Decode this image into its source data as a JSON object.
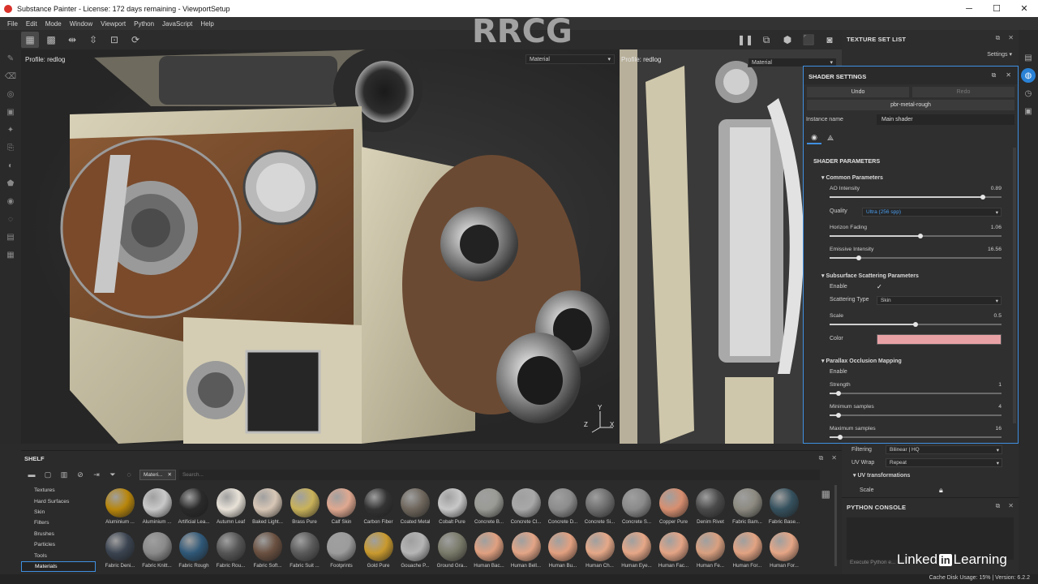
{
  "window": {
    "title": "Substance Painter - License: 172 days remaining - ViewportSetup"
  },
  "menu": [
    "File",
    "Edit",
    "Mode",
    "Window",
    "Viewport",
    "Python",
    "JavaScript",
    "Help"
  ],
  "viewport3d": {
    "profile": "Profile: redlog",
    "channel": "Material",
    "axis_y": "Y",
    "axis_x": "X",
    "axis_z": "Z"
  },
  "viewport2d": {
    "profile": "Profile: redlog",
    "channel": "Material"
  },
  "texture_set_list": {
    "title": "TEXTURE SET LIST",
    "settings": "Settings"
  },
  "shader_settings": {
    "title": "SHADER SETTINGS",
    "undo": "Undo",
    "redo": "Redo",
    "shader": "pbr-metal-rough",
    "instance_label": "Instance name",
    "instance_value": "Main shader",
    "params_header": "SHADER PARAMETERS",
    "common": {
      "title": "Common Parameters",
      "ao_label": "AO Intensity",
      "ao_value": "0.89",
      "ao": 0.89,
      "quality_label": "Quality",
      "quality_value": "Ultra (256 spp)",
      "horizon_label": "Horizon Fading",
      "horizon_value": "1.06",
      "horizon": 0.53,
      "emissive_label": "Emissive Intensity",
      "emissive_value": "16.56",
      "emissive": 0.17
    },
    "sss": {
      "title": "Subsurface Scattering Parameters",
      "enable_label": "Enable",
      "enable_check": "✓",
      "type_label": "Scattering Type",
      "type_value": "Skin",
      "scale_label": "Scale",
      "scale_value": "0.5",
      "scale": 0.5,
      "color_label": "Color",
      "color": "#e8a2a6"
    },
    "pom": {
      "title": "Parallax Occlusion Mapping",
      "enable_label": "Enable",
      "strength_label": "Strength",
      "strength_value": "1",
      "strength": 0.05,
      "min_label": "Minimum samples",
      "min_value": "4",
      "min": 0.05,
      "max_label": "Maximum samples",
      "max_value": "16",
      "max": 0.06
    }
  },
  "properties_peek": {
    "filtering_label": "Filtering",
    "filtering_value": "Bilinear | HQ",
    "uvwrap_label": "UV Wrap",
    "uvwrap_value": "Repeat",
    "uvtrans_label": "UV transformations",
    "scale_label": "Scale"
  },
  "python_console": {
    "title": "PYTHON CONSOLE",
    "hint": "Execute Python e..."
  },
  "shelf": {
    "title": "SHELF",
    "filter_chip": "Materi...",
    "search_placeholder": "Search...",
    "categories": [
      "Textures",
      "Hard Surfaces",
      "Skin",
      "Filters",
      "Brushes",
      "Particles",
      "Tools",
      "Materials"
    ],
    "materials_row1": [
      {
        "name": "Aluminium ...",
        "color": "#b8860b"
      },
      {
        "name": "Aluminium ...",
        "color": "#c9c9c9"
      },
      {
        "name": "Artificial Lea...",
        "color": "#2a2a2a"
      },
      {
        "name": "Autumn Leaf",
        "color": "#e8e2d8"
      },
      {
        "name": "Baked Light...",
        "color": "#d8c7b6"
      },
      {
        "name": "Brass Pure",
        "color": "#c9b25a"
      },
      {
        "name": "Calf Skin",
        "color": "#e0a890"
      },
      {
        "name": "Carbon Fiber",
        "color": "#333333"
      },
      {
        "name": "Coated Metal",
        "color": "#6e665c"
      },
      {
        "name": "Cobalt Pure",
        "color": "#c8c8c8"
      },
      {
        "name": "Concrete B...",
        "color": "#9a9a95"
      },
      {
        "name": "Concrete Cl...",
        "color": "#a8a8a8"
      },
      {
        "name": "Concrete D...",
        "color": "#8c8c8c"
      },
      {
        "name": "Concrete Si...",
        "color": "#6e6e6e"
      },
      {
        "name": "Concrete S...",
        "color": "#8a8a8a"
      },
      {
        "name": "Copper Pure",
        "color": "#d88f70"
      },
      {
        "name": "Denim Rivet",
        "color": "#4a4a4a"
      },
      {
        "name": "Fabric Bam...",
        "color": "#8c8a80"
      },
      {
        "name": "Fabric Base...",
        "color": "#35515e"
      }
    ],
    "materials_row2": [
      {
        "name": "Fabric Deni...",
        "color": "#3a4350"
      },
      {
        "name": "Fabric Knitt...",
        "color": "#8a8a8a"
      },
      {
        "name": "Fabric Rough",
        "color": "#2f5878"
      },
      {
        "name": "Fabric Rou...",
        "color": "#555555"
      },
      {
        "name": "Fabric Soft...",
        "color": "#6a5040"
      },
      {
        "name": "Fabric Suit ...",
        "color": "#5a5a5a"
      },
      {
        "name": "Footprints",
        "color": "#9c9c9c"
      },
      {
        "name": "Gold Pure",
        "color": "#c99a2e"
      },
      {
        "name": "Gouache P...",
        "color": "#b5b5b5"
      },
      {
        "name": "Ground Gra...",
        "color": "#7a7a6a"
      },
      {
        "name": "Human Bac...",
        "color": "#e0a080"
      },
      {
        "name": "Human Bell...",
        "color": "#e3a586"
      },
      {
        "name": "Human Bu...",
        "color": "#e2a080"
      },
      {
        "name": "Human Ch...",
        "color": "#e5a888"
      },
      {
        "name": "Human Eye...",
        "color": "#e6a787"
      },
      {
        "name": "Human Fac...",
        "color": "#e4a485"
      },
      {
        "name": "Human Fe...",
        "color": "#d9a080"
      },
      {
        "name": "Human For...",
        "color": "#e2a382"
      },
      {
        "name": "Human For...",
        "color": "#e5a686"
      }
    ]
  },
  "status": {
    "text": "Cache Disk Usage:  15% | Version: 6.2.2"
  },
  "watermark": {
    "logo": "RRCG",
    "brand_left": "Linked",
    "brand_in": "in",
    "brand_right": " Learning"
  }
}
